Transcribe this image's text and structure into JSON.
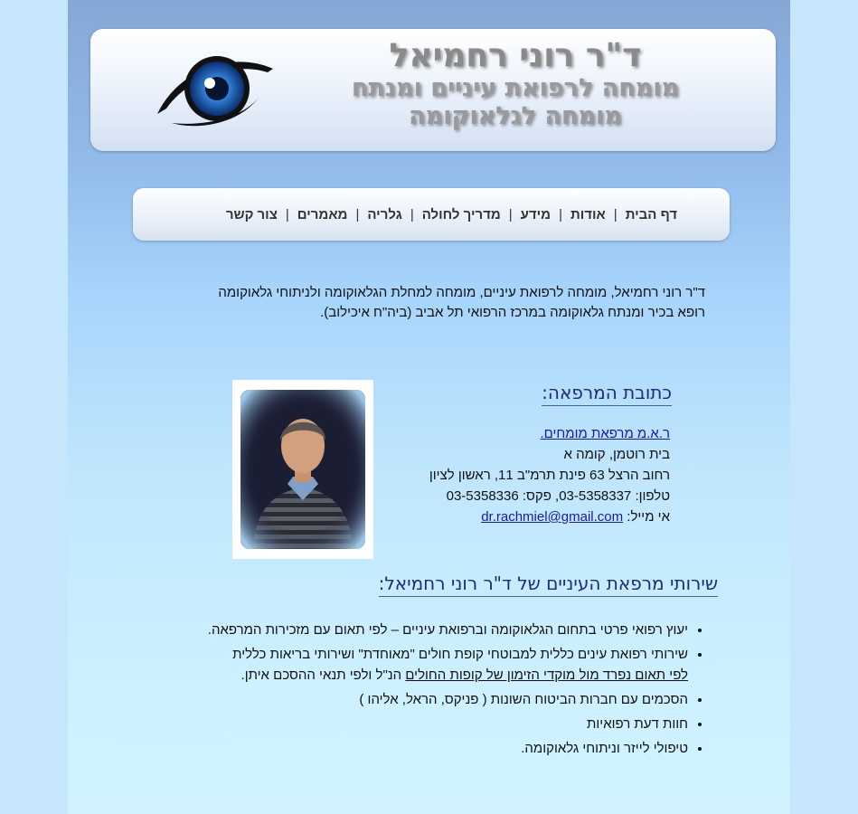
{
  "header": {
    "title": "ד\"ר רוני רחמיאל",
    "subtitle_1": "מומחה לרפואת עיניים ומנתח",
    "subtitle_2": "מומחה לגלאוקומה"
  },
  "nav": {
    "items": [
      {
        "label": "דף הבית"
      },
      {
        "label": "אודות"
      },
      {
        "label": "מידע"
      },
      {
        "label": "מדריך לחולה"
      },
      {
        "label": "גלריה"
      },
      {
        "label": "מאמרים"
      },
      {
        "label": "צור קשר"
      }
    ]
  },
  "intro": {
    "line_1": "ד\"ר רוני רחמיאל, מומחה לרפואת עיניים, מומחה למחלת הגלאוקומה ולניתוחי גלאוקומה",
    "line_2": "רופא בכיר ומנתח גלאוקומה במרכז הרפואי תל אביב (ביה\"ח איכילוב)."
  },
  "clinic": {
    "heading": "כתובת המרפאה:",
    "link": "ר.א.מ מרפאת מומחים.",
    "building": "בית רוטמן, קומה א",
    "street": "רחוב הרצל 63 פינת תרמ\"ב 11, ראשון לציון",
    "phone_line": "טלפון: 03-5358337, פקס: 03-5358336",
    "email_label": "אי מייל:",
    "email": "dr.rachmiel@gmail.com"
  },
  "services": {
    "heading": "שירותי מרפאת העיניים של ד\"ר רוני רחמיאל:",
    "item_1": "יעוץ רפואי פרטי בתחום הגלאוקומה וברפואת עיניים – לפי תאום עם מזכירות המרפאה.",
    "item_2_a": "שירותי רפואת עינים כללית למבוטחי קופת חולים \"מאוחדת\" ושירותי בריאות כללית",
    "item_2_b": "לפי תאום נפרד מול מוקדי הזימון של קופות החולים",
    "item_2_c": " הנ\"ל ולפי תנאי ההסכם איתן.",
    "item_3": "הסכמים עם חברות הביטוח השונות ( פניקס, הראל, אליהו )",
    "item_4": "חוות דעת רפואיות",
    "item_5": "טיפולי לייזר וניתוחי גלאוקומה."
  }
}
